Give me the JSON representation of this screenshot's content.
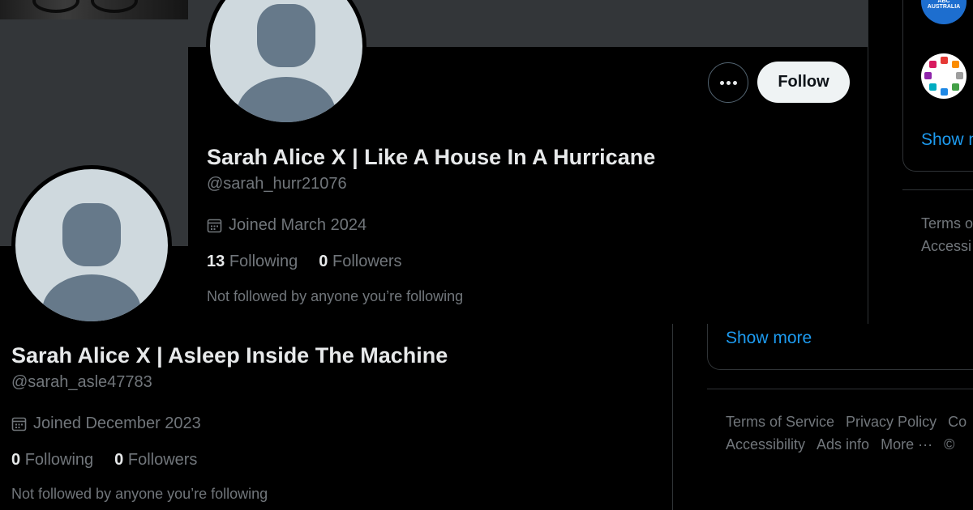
{
  "back_profile": {
    "name": "Sarah Alice X | Asleep Inside The Machine",
    "handle": "@sarah_asle47783",
    "joined": "Joined December 2023",
    "following_count": "0",
    "following_label": "Following",
    "followers_count": "0",
    "followers_label": "Followers",
    "not_followed": "Not followed by anyone you’re following"
  },
  "back_sidebar": {
    "show_more": "Show more",
    "footer_links": [
      "Terms of Service",
      "Privacy Policy",
      "Co",
      "Accessibility",
      "Ads info",
      "More ···",
      "©"
    ]
  },
  "front_profile": {
    "name": "Sarah Alice X | Like A House In A Hurricane",
    "handle": "@sarah_hurr21076",
    "joined": "Joined March 2024",
    "following_count": "13",
    "following_label": "Following",
    "followers_count": "0",
    "followers_label": "Followers",
    "not_followed": "Not followed by anyone you’re following",
    "follow_label": "Follow",
    "more_icon": "more-dots-icon"
  },
  "front_sidebar": {
    "abc_logo_text": "ABC AUSTRALIA",
    "show_more": "Show m",
    "footer_links": [
      "Terms o",
      "Accessi"
    ]
  },
  "colors": {
    "background": "#000000",
    "banner": "#333639",
    "avatar_bg": "#cfd9de",
    "avatar_fg": "#66798a",
    "accent_link": "#1d9bf0",
    "muted_text": "#71767b",
    "primary_text": "#e7e9ea"
  }
}
